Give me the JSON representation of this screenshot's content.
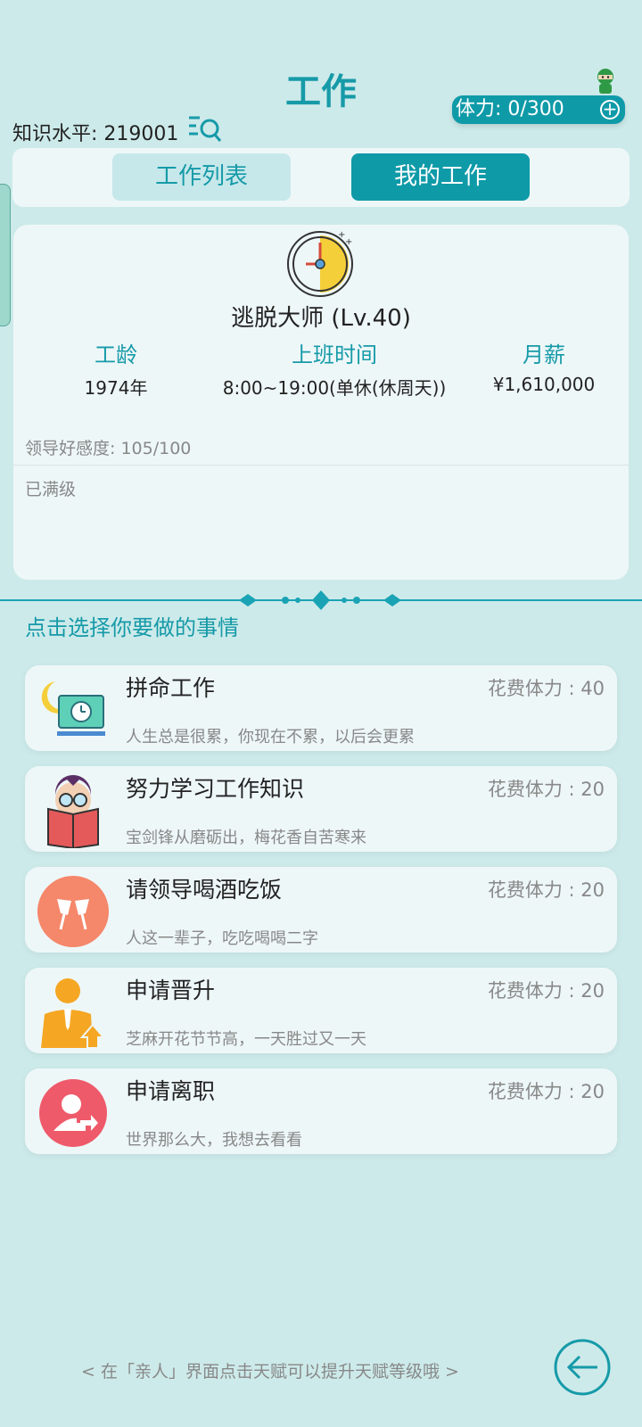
{
  "header": {
    "title": "工作",
    "stamina": "体力: 0/300",
    "stamina_plus": "+",
    "knowledge": "知识水平: 219001"
  },
  "tabs": [
    {
      "label": "工作列表",
      "selected": false
    },
    {
      "label": "我的工作",
      "selected": true
    }
  ],
  "job": {
    "name": "逃脱大师 (Lv.40)",
    "stats": [
      {
        "label": "工龄",
        "value": "1974年"
      },
      {
        "label": "上班时间",
        "value": "8:00~19:00(单休(休周天))"
      },
      {
        "label": "月薪",
        "value": "¥1,610,000"
      }
    ],
    "favor": "领导好感度: 105/100",
    "status": "已满级"
  },
  "prompt": "点击选择你要做的事情",
  "actions": [
    {
      "name": "拼命工作",
      "cost": "花费体力 : 40",
      "desc": "人生总是很累，你现在不累，以后会更累",
      "icon": "night-work-icon"
    },
    {
      "name": "努力学习工作知识",
      "cost": "花费体力 : 20",
      "desc": "宝剑锋从磨砺出，梅花香自苦寒来",
      "icon": "study-book-icon"
    },
    {
      "name": "请领导喝酒吃饭",
      "cost": "花费体力 : 20",
      "desc": "人这一辈子，吃吃喝喝二字",
      "icon": "wine-toast-icon"
    },
    {
      "name": "申请晋升",
      "cost": "花费体力 : 20",
      "desc": "芝麻开花节节高，一天胜过又一天",
      "icon": "promotion-icon"
    },
    {
      "name": "申请离职",
      "cost": "花费体力 : 20",
      "desc": "世界那么大，我想去看看",
      "icon": "resign-icon"
    }
  ],
  "tip": "< 在「亲人」界面点击天赋可以提升天赋等级哦 >",
  "colors": {
    "accent": "#169aa8",
    "accent_dark": "#0f9aa8",
    "background": "#cdeaea",
    "card": "#eef7f8"
  }
}
